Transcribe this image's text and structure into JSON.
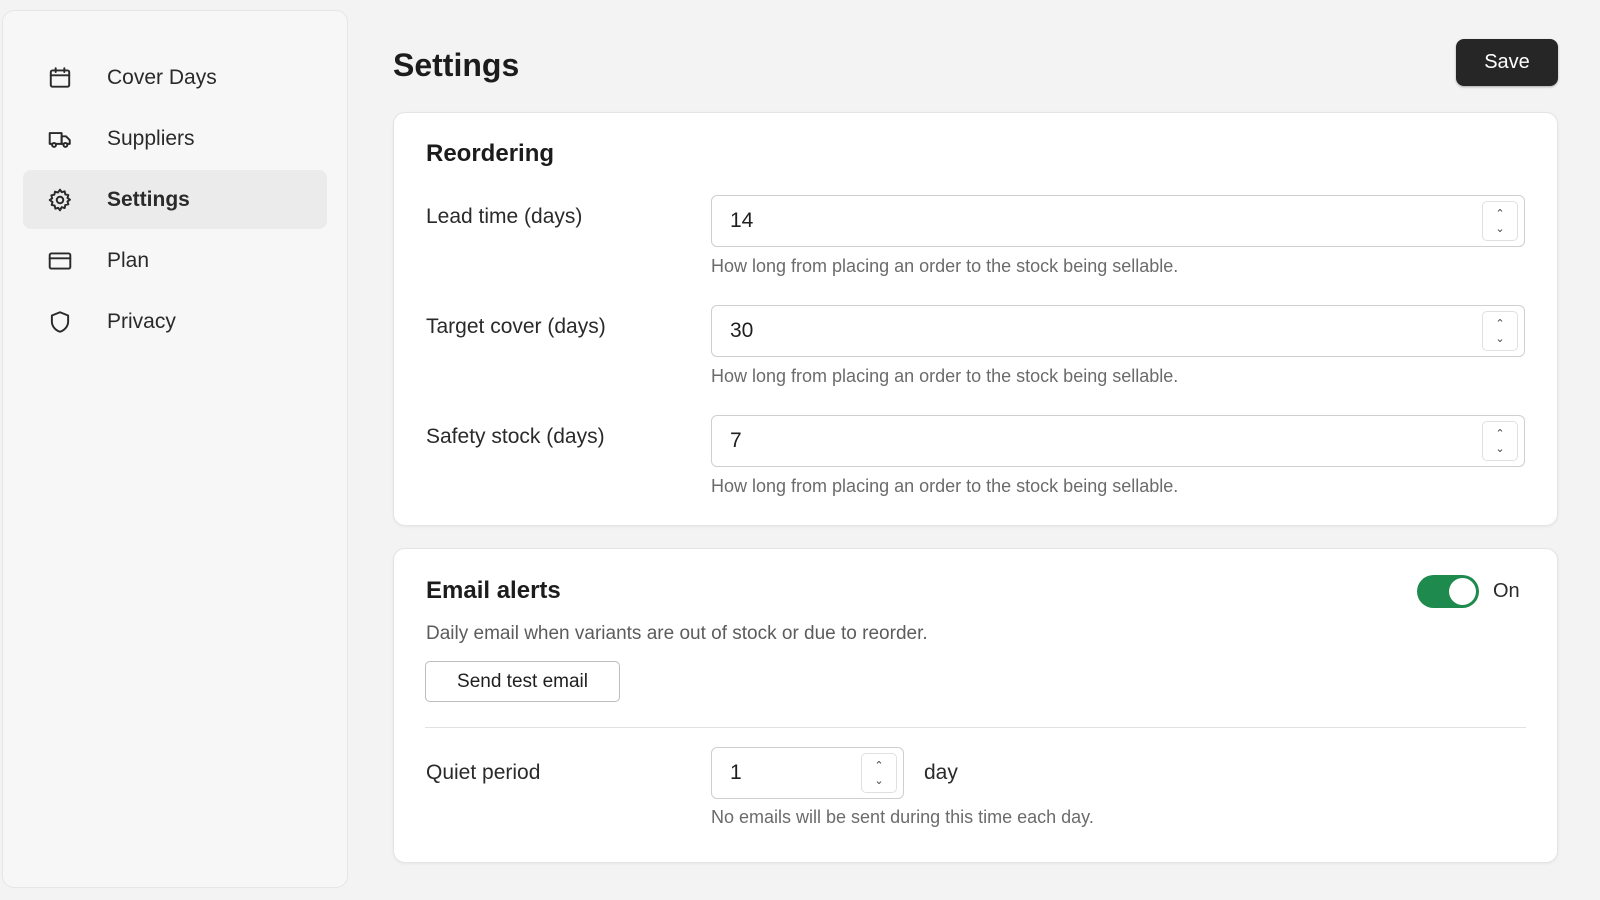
{
  "sidebar": {
    "items": [
      {
        "label": "Cover Days",
        "icon": "calendar-icon"
      },
      {
        "label": "Suppliers",
        "icon": "truck-icon"
      },
      {
        "label": "Settings",
        "icon": "gear-icon",
        "active": true
      },
      {
        "label": "Plan",
        "icon": "credit-card-icon"
      },
      {
        "label": "Privacy",
        "icon": "shield-icon"
      }
    ]
  },
  "header": {
    "title": "Settings",
    "save_label": "Save"
  },
  "reordering": {
    "title": "Reordering",
    "fields": [
      {
        "label": "Lead time (days)",
        "value": "14",
        "help": "How long from placing an order to the stock being sellable."
      },
      {
        "label": "Target cover (days)",
        "value": "30",
        "help": "How long from placing an order to the stock being sellable."
      },
      {
        "label": "Safety stock (days)",
        "value": "7",
        "help": "How long from placing an order to the stock being sellable."
      }
    ]
  },
  "email_alerts": {
    "title": "Email alerts",
    "toggle_on": true,
    "toggle_label": "On",
    "toggle_color": "#1e8a4e",
    "description": "Daily email when variants are out of stock or due to reorder.",
    "test_button": "Send test email",
    "quiet_period": {
      "label": "Quiet period",
      "value": "1",
      "unit": "day",
      "help": "No emails will be sent during this time each day."
    }
  }
}
